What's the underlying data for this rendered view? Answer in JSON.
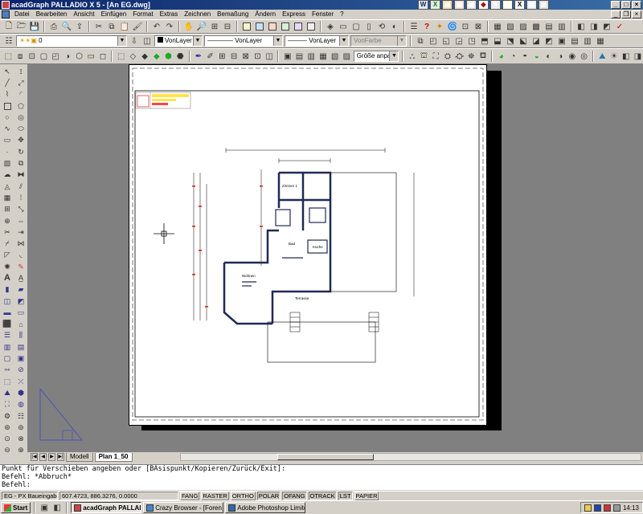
{
  "window": {
    "title": "acadGraph PALLADIO X 5 - [An EG.dwg]"
  },
  "colors": {
    "title_start": "#0a246a",
    "title_end": "#3a6ea5",
    "wall": "#1f2a55",
    "dim": "#cc2222",
    "ucs": "#4c55b0"
  },
  "menu": [
    "Datei",
    "Bearbeiten",
    "Ansicht",
    "Einfügen",
    "Format",
    "Extras",
    "Zeichnen",
    "Bemaßung",
    "Ändern",
    "Express",
    "Fenster",
    "?"
  ],
  "toolbar2": {
    "layer_value": "0",
    "color_value": "VonLayer",
    "linetype_value": "VonLayer",
    "lineweight_value": "VonLayer",
    "plotstyle_value": "VonFarbe"
  },
  "toolbar3": {
    "zoom_value": "Größe anpassen"
  },
  "drawing": {
    "rooms": [
      "Zimmer 1",
      "Bad",
      "Küche",
      "Wohnen",
      "Terrasse"
    ]
  },
  "layout_tabs": {
    "tabs": [
      "Modell",
      "Plan 1_50"
    ],
    "active": "Plan 1_50"
  },
  "command_lines": [
    "Punkt für Verschieben angeben oder [BAsispunkt/Kopieren/Zurück/Exit]:",
    "Befehl: *Abbruch*",
    "Befehl:"
  ],
  "status": {
    "layer_info": "EG - PX Baueingabe",
    "coords": "607.4723, 886.3276, 0.0000",
    "toggles": [
      "FANG",
      "RASTER",
      "ORTHO",
      "POLAR",
      "OFANG",
      "OTRACK",
      "LST",
      "PAPIER"
    ]
  },
  "taskbar": {
    "start_label": "Start",
    "tasks": [
      "acadGraph PALLADIO ...",
      "Crazy Browser - [Foren a...",
      "Adobe Photoshop Limited ..."
    ],
    "active_task": 0,
    "clock": "14:13"
  }
}
